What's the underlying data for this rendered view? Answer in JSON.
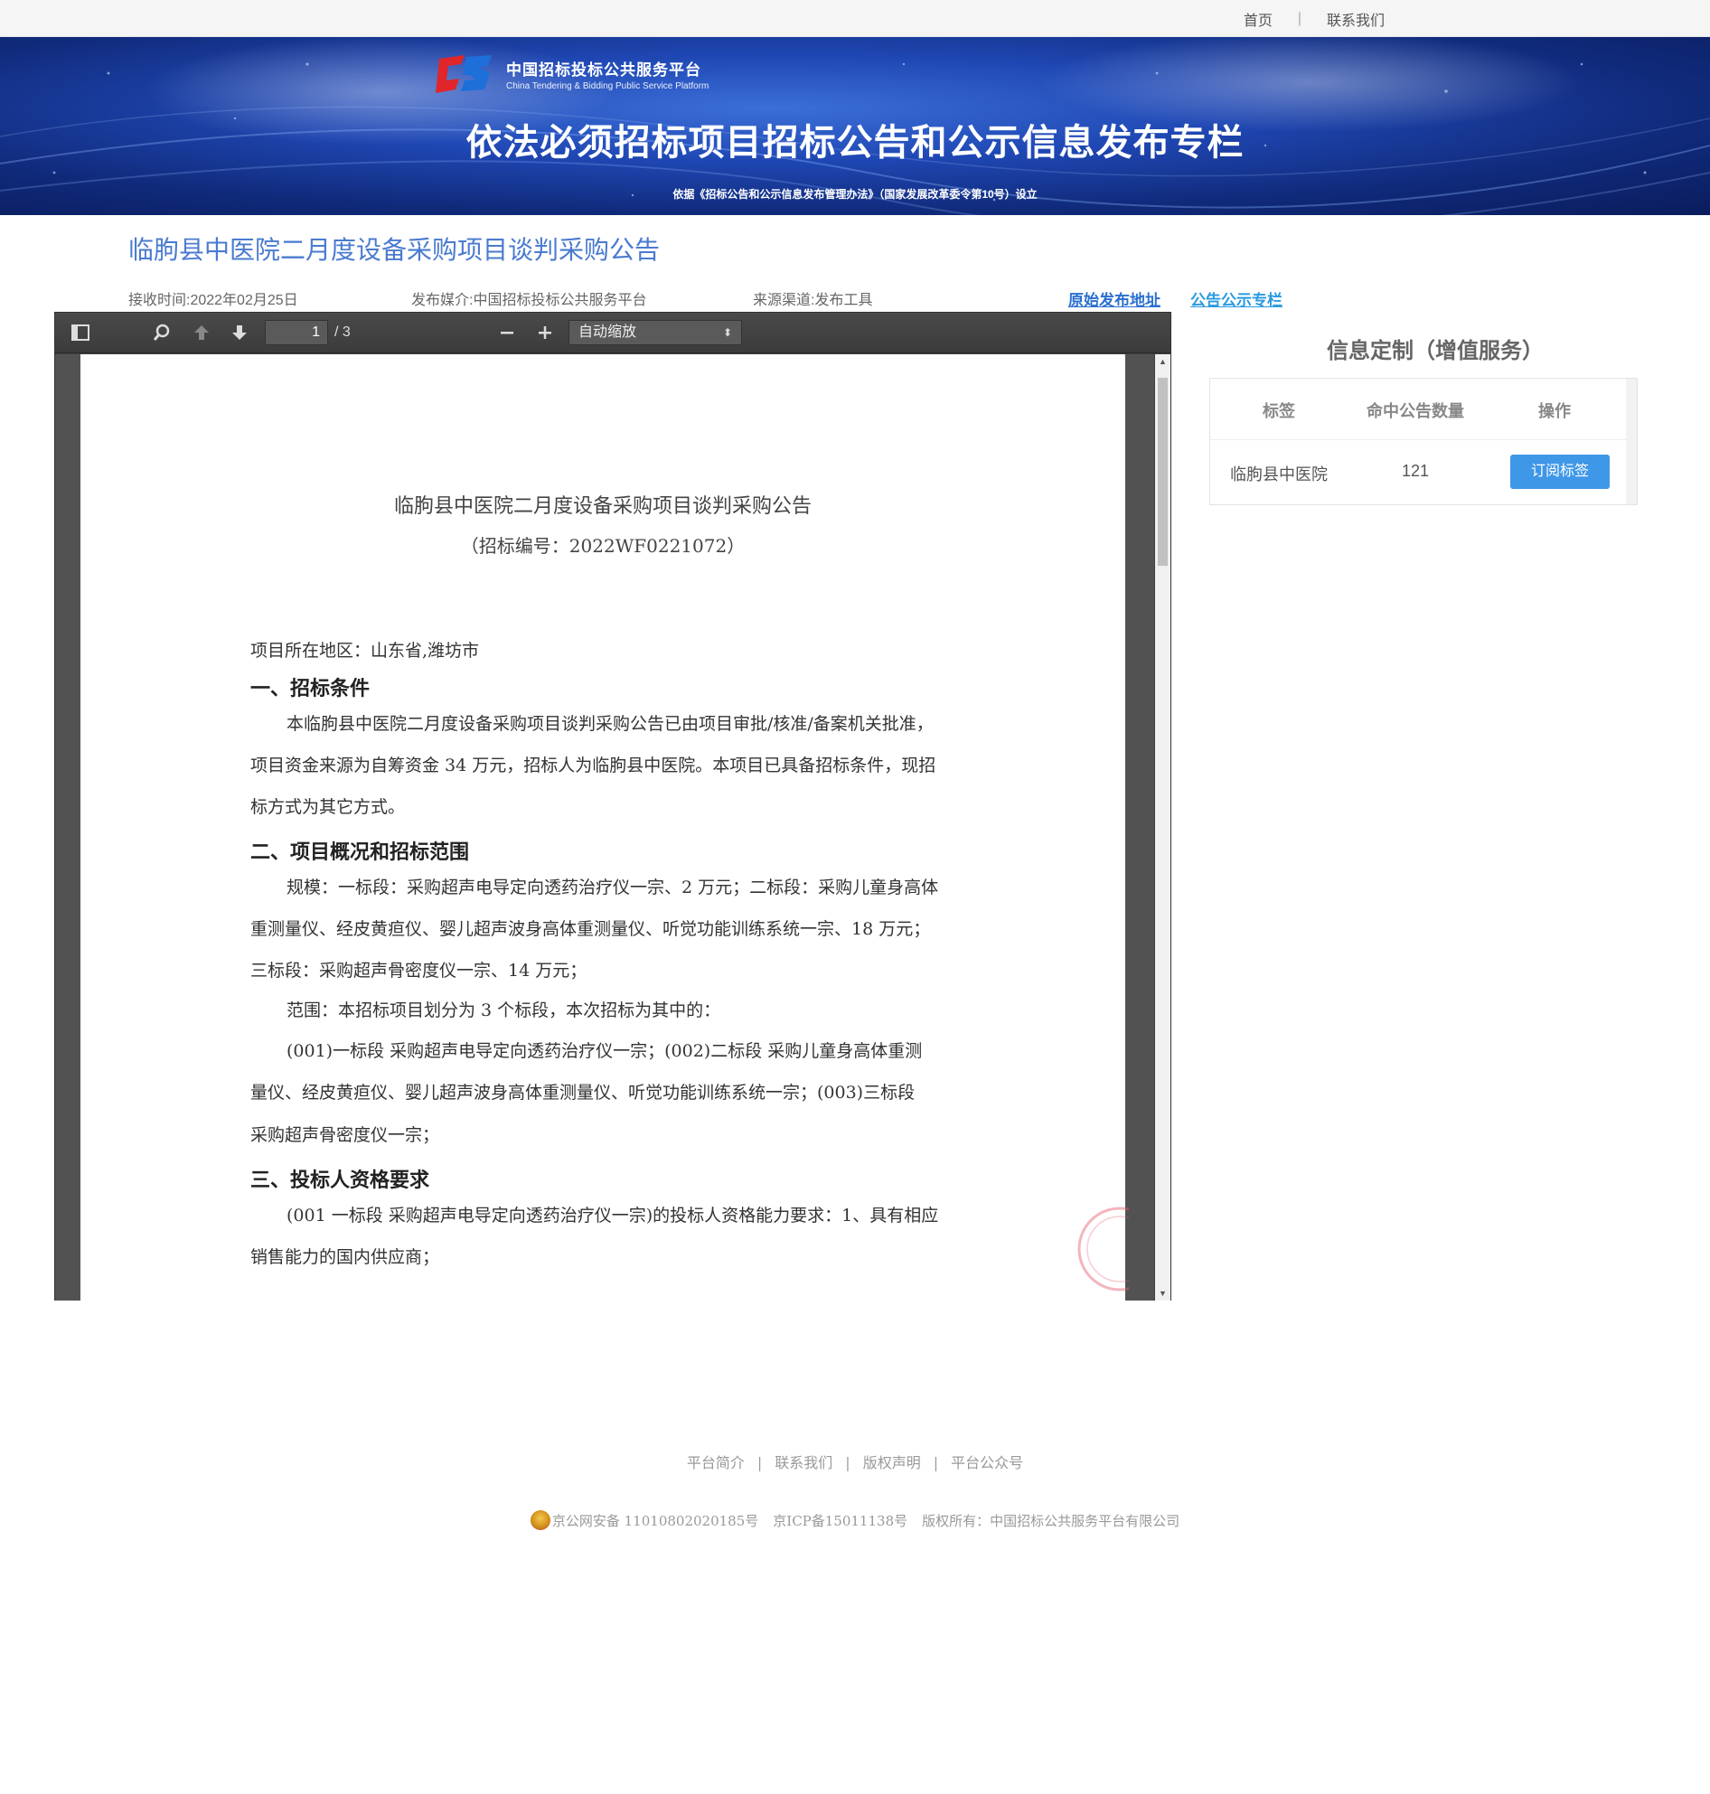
{
  "topnav": {
    "home": "首页",
    "contact": "联系我们"
  },
  "banner": {
    "logo_cn": "中国招标投标公共服务平台",
    "logo_en": "China Tendering & Bidding Public Service Platform",
    "title": "依法必须招标项目招标公告和公示信息发布专栏",
    "subtitle": "依据《招标公告和公示信息发布管理办法》（国家发展改革委令第10号）设立"
  },
  "notice": {
    "title": "临朐县中医院二月度设备采购项目谈判采购公告",
    "received": "接收时间:2022年02月25日",
    "media": "发布媒介:中国招标投标公共服务平台",
    "source": "来源渠道:发布工具",
    "link_original": "原始发布地址",
    "link_column": "公告公示专栏"
  },
  "viewer": {
    "page_current": "1",
    "page_total": "/ 3",
    "zoom": "自动缩放",
    "icons": [
      "sidebar-toggle-icon",
      "search-icon",
      "page-up-icon",
      "page-down-icon",
      "zoom-out-icon",
      "zoom-in-icon"
    ]
  },
  "document": {
    "title": "临朐县中医院二月度设备采购项目谈判采购公告",
    "code": "（招标编号：2022WF0221072）",
    "region": "项目所在地区：山东省,潍坊市",
    "h1": "一、招标条件",
    "p1": [
      "本临朐县中医院二月度设备采购项目谈判采购公告已由项目审批/核准/备案机关批准，",
      "项目资金来源为自筹资金 34 万元，招标人为临朐县中医院。本项目已具备招标条件，现招",
      "标方式为其它方式。"
    ],
    "h2": "二、项目概况和招标范围",
    "p2": [
      "规模：一标段：采购超声电导定向透药治疗仪一宗、2 万元；二标段：采购儿童身高体",
      "重测量仪、经皮黄疸仪、婴儿超声波身高体重测量仪、听觉功能训练系统一宗、18 万元；",
      "三标段：采购超声骨密度仪一宗、14 万元；",
      "范围：本招标项目划分为 3 个标段，本次招标为其中的：",
      "(001)一标段  采购超声电导定向透药治疗仪一宗；(002)二标段  采购儿童身高体重测",
      "量仪、经皮黄疸仪、婴儿超声波身高体重测量仪、听觉功能训练系统一宗；(003)三标段",
      "采购超声骨密度仪一宗；"
    ],
    "h3": "三、投标人资格要求",
    "p3": [
      "(001 一标段  采购超声电导定向透药治疗仪一宗)的投标人资格能力要求：1、具有相应",
      "销售能力的国内供应商；"
    ]
  },
  "panel": {
    "title": "信息定制（增值服务）",
    "headers": [
      "标签",
      "命中公告数量",
      "操作"
    ],
    "rows": [
      {
        "tag": "临朐县中医院",
        "count": "121",
        "action": "订阅标签"
      }
    ]
  },
  "footer": {
    "links": [
      "平台简介",
      "联系我们",
      "版权声明",
      "平台公众号"
    ],
    "icp_police": "京公网安备 11010802020185号",
    "icp": "京ICP备15011138号",
    "copyright": "版权所有：中国招标公共服务平台有限公司"
  },
  "colors": {
    "title_blue": "#4a7bd0",
    "link_blue": "#2a6fd0",
    "button_blue": "#3f97e8",
    "banner_blue": "#1f47b3"
  }
}
